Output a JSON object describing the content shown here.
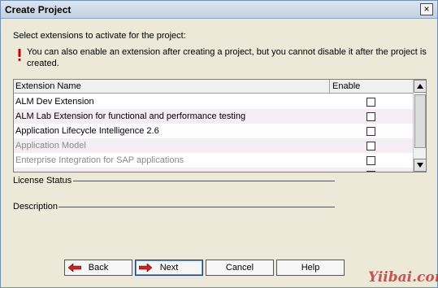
{
  "window": {
    "title": "Create Project",
    "close_label": "×"
  },
  "prompt": "Select extensions to activate for the project:",
  "info_text": "You can also enable an extension after creating a project, but you cannot disable it after the project is created.",
  "grid": {
    "headers": {
      "name": "Extension Name",
      "enable": "Enable"
    },
    "rows": [
      {
        "label": "ALM Dev Extension",
        "enabled": false,
        "disabled": false
      },
      {
        "label": "ALM Lab Extension for functional and performance testing",
        "enabled": false,
        "disabled": false
      },
      {
        "label": "Application Lifecycle Intelligence 2.6",
        "enabled": false,
        "disabled": false
      },
      {
        "label": "Application Model",
        "enabled": false,
        "disabled": true
      },
      {
        "label": "Enterprise Integration for SAP applications",
        "enabled": false,
        "disabled": true
      }
    ]
  },
  "license_status_label": "License Status",
  "description_label": "Description",
  "buttons": {
    "back": "Back",
    "next": "Next",
    "cancel": "Cancel",
    "help": "Help"
  },
  "watermark": "Yiibai.com",
  "colors": {
    "title_bar": "#c3d1e3",
    "dialog_bg": "#ece9d8",
    "alt_row": "#f4eef4",
    "arrow_red": "#cc2222",
    "info_red": "#c00000"
  }
}
